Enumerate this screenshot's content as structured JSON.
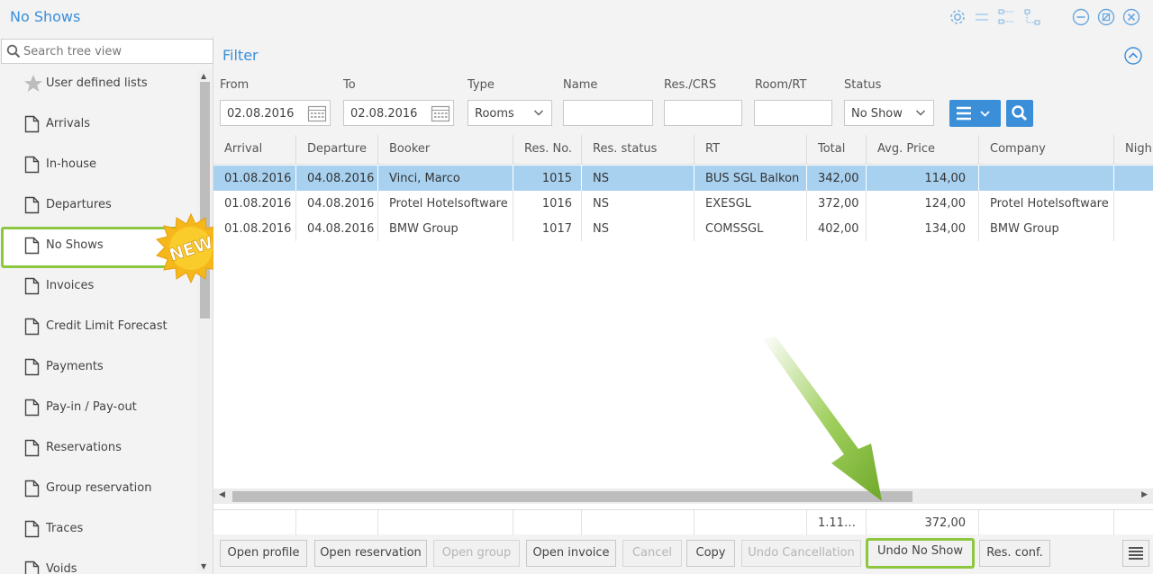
{
  "window": {
    "title": "No Shows",
    "icons": [
      "gear-icon",
      "toggle-icon",
      "tree-expand-icon",
      "tree-collapse-icon",
      "minimize-icon",
      "restore-icon",
      "close-icon"
    ]
  },
  "sidebar": {
    "search_placeholder": "Search tree view",
    "items": [
      {
        "label": "User defined lists",
        "icon": "star-icon"
      },
      {
        "label": "Arrivals",
        "icon": "document-icon"
      },
      {
        "label": "In-house",
        "icon": "document-icon"
      },
      {
        "label": "Departures",
        "icon": "document-icon"
      },
      {
        "label": "No Shows",
        "icon": "document-icon",
        "selected": true
      },
      {
        "label": "Invoices",
        "icon": "document-icon"
      },
      {
        "label": "Credit Limit Forecast",
        "icon": "document-icon"
      },
      {
        "label": "Payments",
        "icon": "document-icon"
      },
      {
        "label": "Pay-in / Pay-out",
        "icon": "document-icon"
      },
      {
        "label": "Reservations",
        "icon": "document-icon"
      },
      {
        "label": "Group reservation",
        "icon": "document-icon"
      },
      {
        "label": "Traces",
        "icon": "document-icon"
      },
      {
        "label": "Voids",
        "icon": "document-icon"
      }
    ],
    "badge": "NEW"
  },
  "filter": {
    "title": "Filter",
    "from_label": "From",
    "from_value": "02.08.2016",
    "to_label": "To",
    "to_value": "02.08.2016",
    "type_label": "Type",
    "type_value": "Rooms",
    "name_label": "Name",
    "name_value": "",
    "res_label": "Res./CRS",
    "res_value": "",
    "room_label": "Room/RT",
    "room_value": "",
    "status_label": "Status",
    "status_value": "No Show"
  },
  "grid": {
    "columns": [
      "Arrival",
      "Departure",
      "Booker",
      "Res. No.",
      "Res. status",
      "RT",
      "Total",
      "Avg. Price",
      "Company",
      "Nigh"
    ],
    "rows": [
      {
        "arrival": "01.08.2016",
        "departure": "04.08.2016",
        "booker": "Vinci, Marco",
        "res_no": "1015",
        "res_status": "NS",
        "rt": "BUS SGL Balkon",
        "total": "342,00",
        "avg_price": "114,00",
        "company": "",
        "selected": true
      },
      {
        "arrival": "01.08.2016",
        "departure": "04.08.2016",
        "booker": "Protel Hotelsoftware",
        "res_no": "1016",
        "res_status": "NS",
        "rt": "EXESGL",
        "total": "372,00",
        "avg_price": "124,00",
        "company": "Protel Hotelsoftware"
      },
      {
        "arrival": "01.08.2016",
        "departure": "04.08.2016",
        "booker": "BMW Group",
        "res_no": "1017",
        "res_status": "NS",
        "rt": "COMSSGL",
        "total": "402,00",
        "avg_price": "134,00",
        "company": "BMW Group"
      }
    ],
    "totals": {
      "total": "1.11…",
      "avg_price": "372,00"
    }
  },
  "actions": {
    "open_profile": "Open profile",
    "open_reservation": "Open reservation",
    "open_group": "Open group",
    "open_invoice": "Open invoice",
    "cancel": "Cancel",
    "copy": "Copy",
    "undo_cancellation": "Undo Cancellation",
    "undo_no_show": "Undo No Show",
    "res_conf": "Res. conf."
  },
  "colors": {
    "accent": "#3b8fd9",
    "highlight": "#8dc63f",
    "selected_row": "#a8d1f0",
    "badge": "#f7c21b"
  }
}
